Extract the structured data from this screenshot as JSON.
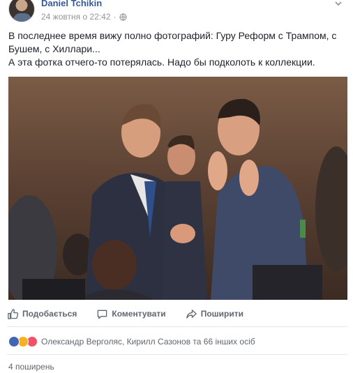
{
  "post": {
    "author": "Daniel Tchikin",
    "timestamp": "24 жовтня о 22:42",
    "privacy_icon": "globe-icon",
    "text_lines": [
      "В последнее время вижу полно фотографий: Гуру Реформ с Трампом, с",
      "Бушем, с Хиллари...",
      "А эта фотка отчего-то потерялась. Надо бы подколоть к коллекции."
    ]
  },
  "actions": {
    "like_label": "Подобається",
    "comment_label": "Коментувати",
    "share_label": "Поширити"
  },
  "reactions": {
    "icons": [
      "like-icon",
      "haha-icon",
      "love-icon"
    ],
    "names_text": "Олександр Верголяс, Кирилл Сазонов та 66 інших осіб"
  },
  "shares_text": "4 поширень",
  "colors": {
    "link": "#365899",
    "meta": "#90949c",
    "action": "#606770",
    "like": "#4267b2",
    "haha": "#f7b125",
    "love": "#f25268"
  }
}
